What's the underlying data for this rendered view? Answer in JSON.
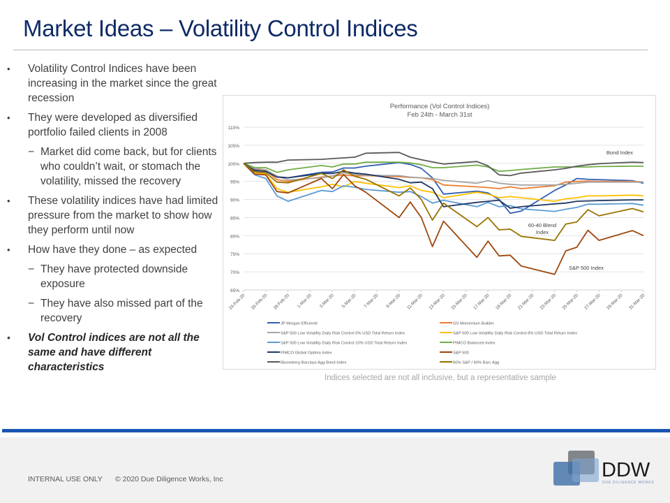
{
  "slide": {
    "title": "Market Ideas – Volatility Control Indices",
    "bullets": [
      {
        "level": 1,
        "text": "Volatility Control Indices have been increasing in the market since the great recession"
      },
      {
        "level": 1,
        "text": "They were developed as diversified portfolio failed clients in 2008"
      },
      {
        "level": 2,
        "text": "Market did come back, but for clients who couldn’t wait, or stomach the volatility, missed the recovery"
      },
      {
        "level": 1,
        "text": "These volatility indices have had limited pressure from the market to show how they perform until now"
      },
      {
        "level": 1,
        "text": "How have they done – as expected"
      },
      {
        "level": 2,
        "text": "They have protected downside exposure"
      },
      {
        "level": 2,
        "text": "They have also missed part of the recovery"
      },
      {
        "level": 1,
        "emphasis": true,
        "text": "Vol Control indices are not all the same and have different characteristics"
      }
    ],
    "caption": "Indices selected are not all inclusive, but a representative  sample",
    "footer": {
      "classification": "INTERNAL USE ONLY",
      "copyright": "© 2020 Due Diligence Works, Inc",
      "logo_text": "DDW",
      "logo_subtext": "DUE DILIGENCE WORKS"
    },
    "colors": {
      "title": "#0e2a66",
      "footer_band": "#1b55b4"
    }
  },
  "chart_data": {
    "type": "line",
    "title": "Performance (Vol Control Indices)",
    "subtitle": "Feb 24th - March 31st",
    "xlabel": "",
    "ylabel": "",
    "ylim": [
      65,
      110
    ],
    "yticks": [
      65,
      70,
      75,
      80,
      85,
      90,
      95,
      100,
      105,
      110
    ],
    "ytick_labels": [
      "65%",
      "70%",
      "75%",
      "80%",
      "85%",
      "90%",
      "95%",
      "100%",
      "105%",
      "110%"
    ],
    "xtick_labels": [
      "24-Feb-20",
      "26-Feb-20",
      "28-Feb-20",
      "1-Mar-20",
      "3-Mar-20",
      "5-Mar-20",
      "7-Mar-20",
      "9-Mar-20",
      "11-Mar-20",
      "13-Mar-20",
      "15-Mar-20",
      "17-Mar-20",
      "19-Mar-20",
      "21-Mar-20",
      "23-Mar-20",
      "25-Mar-20",
      "27-Mar-20",
      "29-Mar-20",
      "31-Mar-20"
    ],
    "xtick_days": [
      0,
      2,
      4,
      6,
      8,
      10,
      12,
      14,
      16,
      18,
      20,
      22,
      24,
      26,
      28,
      30,
      32,
      34,
      36
    ],
    "x_days": [
      0,
      1,
      2,
      3,
      4,
      7,
      8,
      9,
      10,
      11,
      14,
      15,
      16,
      17,
      18,
      21,
      22,
      23,
      24,
      25,
      28,
      29,
      30,
      31,
      32,
      35,
      36
    ],
    "x_dates": [
      "24-Feb",
      "25-Feb",
      "26-Feb",
      "27-Feb",
      "28-Feb",
      "2-Mar",
      "3-Mar",
      "4-Mar",
      "5-Mar",
      "6-Mar",
      "9-Mar",
      "10-Mar",
      "11-Mar",
      "12-Mar",
      "13-Mar",
      "16-Mar",
      "17-Mar",
      "18-Mar",
      "19-Mar",
      "20-Mar",
      "23-Mar",
      "24-Mar",
      "25-Mar",
      "26-Mar",
      "27-Mar",
      "30-Mar",
      "31-Mar"
    ],
    "grid": true,
    "legend": "bottom",
    "annotations": [
      {
        "text": "Bond Index",
        "near_series": "Bloomberg Barclays Agg Bond Index"
      },
      {
        "text": "60-40 Blend Index",
        "near_series": "60% S&P / 40% Barc Agg"
      },
      {
        "text": "S&P 500 Index",
        "near_series": "S&P 500"
      }
    ],
    "series": [
      {
        "name": "JP Morgan Efficiente",
        "color": "#2f5fb3",
        "values": [
          100,
          98.3,
          97.9,
          96.3,
          96.0,
          97.5,
          97.6,
          98.7,
          98.7,
          99.2,
          100.2,
          99.7,
          98.6,
          96.0,
          91.5,
          92.3,
          91.8,
          90.0,
          86.2,
          86.8,
          92.5,
          94.0,
          95.8,
          95.6,
          95.5,
          95.2,
          94.5
        ]
      },
      {
        "name": "GS Momentum Builder",
        "color": "#ed7d31",
        "values": [
          100,
          98.5,
          98.0,
          95.5,
          95.0,
          96.2,
          96.5,
          96.8,
          96.5,
          96.6,
          96.3,
          96.1,
          96.0,
          95.5,
          94.0,
          93.5,
          93.3,
          93.0,
          93.5,
          93.0,
          93.8,
          94.8,
          95.0,
          95.1,
          95.0,
          95.0,
          94.8
        ]
      },
      {
        "name": "S&P 500 Low Volatility Daily Risk Control 5% USD Total Return Index",
        "color": "#a5a5a5",
        "values": [
          100,
          98.6,
          98.2,
          96.5,
          95.4,
          96.0,
          96.5,
          97.4,
          96.9,
          96.7,
          96.6,
          96.2,
          96.0,
          95.8,
          95.3,
          94.5,
          95.2,
          94.5,
          94.2,
          94.0,
          94.0,
          94.2,
          94.5,
          94.8,
          94.8,
          94.8,
          94.8
        ]
      },
      {
        "name": "S&P 500 Low Volatility Daily Risk Control 8% USD Total Return Index",
        "color": "#ffc000",
        "values": [
          100,
          97.5,
          97.0,
          93.0,
          92.0,
          93.5,
          94.2,
          93.5,
          95.0,
          94.5,
          93.3,
          93.8,
          92.5,
          92.0,
          90.5,
          92.0,
          91.5,
          90.5,
          90.8,
          90.5,
          89.5,
          90.2,
          90.5,
          91.0,
          91.0,
          91.2,
          91.0
        ]
      },
      {
        "name": "S&P 500 Low Volatility Daily Risk Control 10% USD Total Return Index",
        "color": "#5b9bd5",
        "values": [
          100,
          96.8,
          95.8,
          91.0,
          89.5,
          92.5,
          92.2,
          93.8,
          93.4,
          92.8,
          92.0,
          92.2,
          90.8,
          89.0,
          89.8,
          88.0,
          89.2,
          88.0,
          88.3,
          87.4,
          86.7,
          87.3,
          87.8,
          88.7,
          88.7,
          88.9,
          88.4
        ]
      },
      {
        "name": "PIMCO Balanced Index",
        "color": "#70ad47",
        "values": [
          100,
          98.8,
          98.8,
          97.5,
          98.2,
          99.4,
          99.0,
          99.8,
          99.8,
          100.3,
          100.3,
          100.1,
          99.6,
          98.8,
          98.8,
          99.5,
          99.0,
          97.8,
          98.0,
          98.3,
          99.0,
          99.0,
          99.0,
          99.0,
          99.1,
          99.2,
          99.2
        ]
      },
      {
        "name": "PIMCO Global Optima Index",
        "color": "#1f3864",
        "values": [
          100,
          98.0,
          97.8,
          96.2,
          96.0,
          97.2,
          97.2,
          97.8,
          97.3,
          97.0,
          95.6,
          94.6,
          94.8,
          93.0,
          88.0,
          89.2,
          89.5,
          89.8,
          87.6,
          88.0,
          88.8,
          89.0,
          89.5,
          89.6,
          89.7,
          89.9,
          89.9
        ]
      },
      {
        "name": "S&P 500",
        "color": "#9e480e",
        "values": [
          100,
          97.0,
          96.8,
          92.2,
          91.8,
          95.8,
          93.0,
          96.9,
          93.8,
          92.0,
          85.0,
          89.3,
          85.0,
          77.0,
          84.0,
          74.0,
          78.5,
          74.4,
          74.6,
          71.6,
          69.3,
          75.8,
          76.8,
          81.5,
          78.7,
          81.4,
          80.0
        ]
      },
      {
        "name": "Bloomberg Barclays Agg Bond Index",
        "color": "#595959",
        "values": [
          100,
          100.2,
          100.3,
          100.3,
          100.9,
          101.1,
          101.3,
          101.5,
          101.7,
          102.8,
          103.0,
          101.7,
          101.0,
          100.4,
          99.8,
          100.5,
          99.3,
          96.8,
          96.6,
          97.3,
          98.2,
          98.6,
          99.2,
          99.6,
          99.9,
          100.3,
          100.2
        ]
      },
      {
        "name": "60% S&P / 40% Barc Agg",
        "color": "#997300",
        "values": [
          100,
          97.6,
          97.4,
          94.8,
          94.6,
          97.2,
          95.8,
          98.2,
          96.4,
          95.6,
          91.0,
          93.2,
          90.0,
          84.3,
          89.0,
          82.5,
          85.0,
          81.6,
          81.8,
          79.8,
          78.7,
          83.2,
          83.8,
          87.2,
          85.5,
          87.5,
          86.6
        ]
      }
    ]
  }
}
